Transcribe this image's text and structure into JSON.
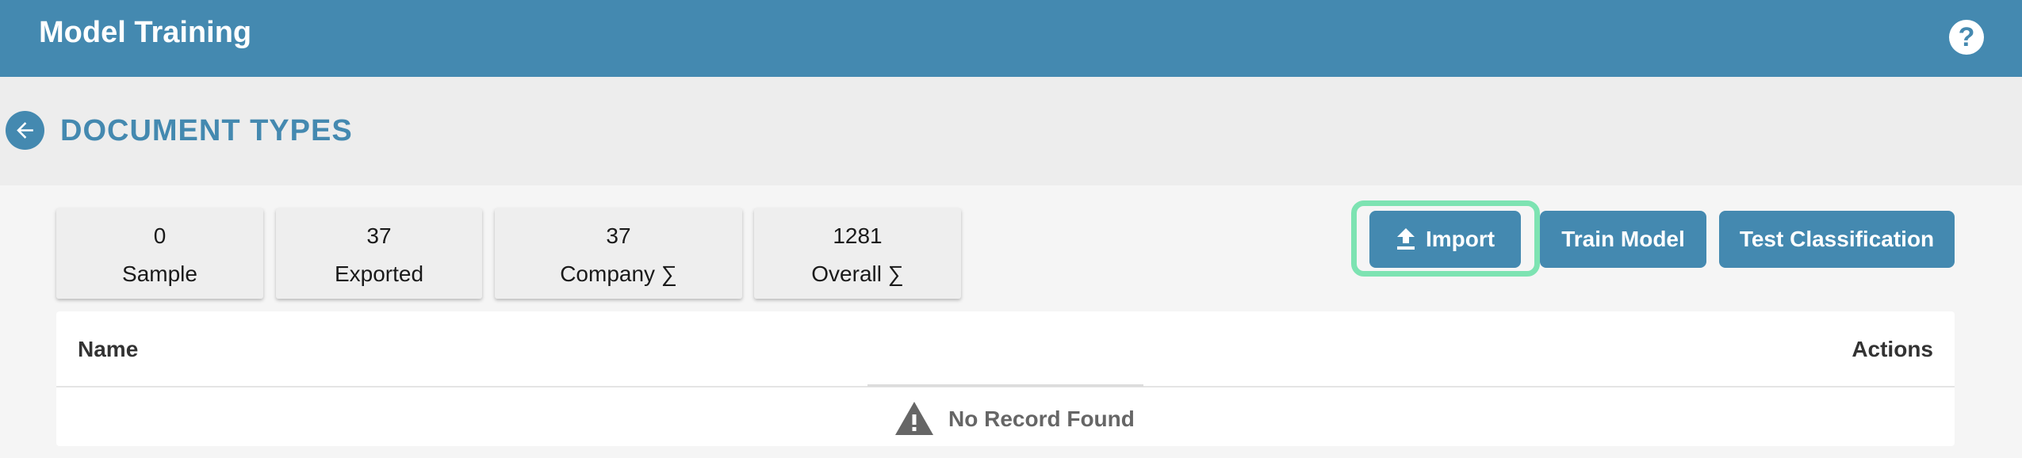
{
  "appbar": {
    "title": "Model Training",
    "help_label": "?"
  },
  "header": {
    "page_title": "DOCUMENT TYPES"
  },
  "stats": [
    {
      "value": "0",
      "label": "Sample"
    },
    {
      "value": "37",
      "label": "Exported"
    },
    {
      "value": "37",
      "label": "Company ∑"
    },
    {
      "value": "1281",
      "label": "Overall ∑"
    }
  ],
  "toolbar": {
    "import_label": "Import",
    "train_label": "Train Model",
    "test_label": "Test Classification"
  },
  "table": {
    "columns": [
      "Name",
      "Actions"
    ],
    "rows": [],
    "empty_message": "No Record Found"
  },
  "colors": {
    "primary": "#4489b0",
    "highlight": "#7de3b2",
    "background": "#f5f5f5"
  },
  "icons": {
    "help": "help-circle-icon",
    "back": "arrow-left-icon",
    "import": "upload-icon",
    "empty": "warning-triangle-icon"
  }
}
